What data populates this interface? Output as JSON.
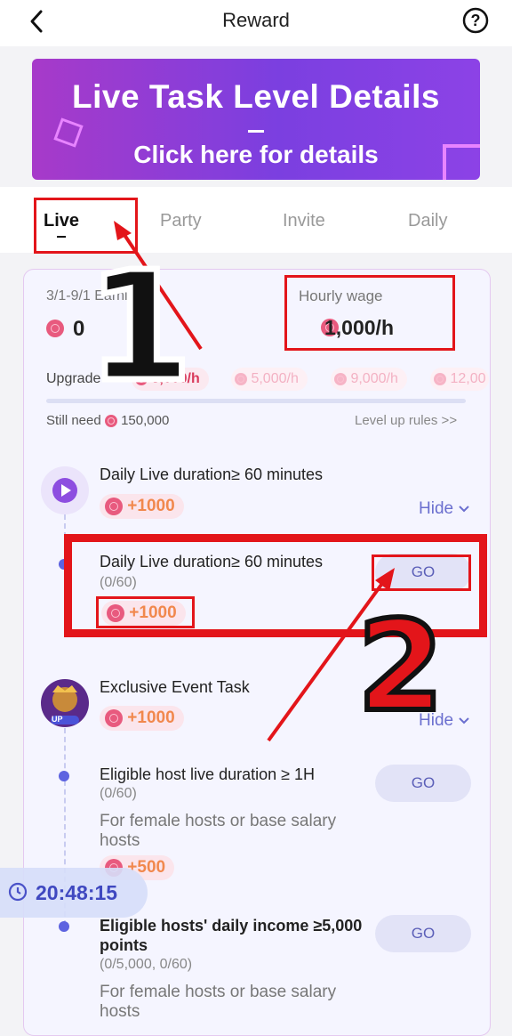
{
  "header": {
    "title": "Reward"
  },
  "banner": {
    "line1": "Live Task Level Details",
    "dash": "—",
    "line2": "Click here for details"
  },
  "tabs": [
    {
      "label": "Live"
    },
    {
      "label": "Party"
    },
    {
      "label": "Invite"
    },
    {
      "label": "Daily"
    }
  ],
  "earnings": {
    "period_label": "3/1-9/1 Earnings:",
    "value": "0",
    "hourly_label": "Hourly wage",
    "hourly_value": "1,000/h"
  },
  "upgrade": {
    "label": "Upgrade",
    "levels": [
      "3,000/h",
      "5,000/h",
      "9,000/h",
      "12,00"
    ],
    "still_need_label": "Still need",
    "still_need_value": "150,000",
    "rules_link": "Level up rules >>",
    "progress": 0
  },
  "task1": {
    "title": "Daily Live duration≥ 60 minutes",
    "bonus": "+1000",
    "hide_label": "Hide",
    "sub": {
      "title": "Daily Live duration≥ 60 minutes",
      "progress": "(0/60)",
      "bonus": "+1000",
      "go_label": "GO"
    }
  },
  "task2": {
    "title": "Exclusive Event Task",
    "badge": "UP",
    "bonus": "+1000",
    "hide_label": "Hide",
    "subs": [
      {
        "title": "Eligible host live duration ≥ 1H",
        "progress": "(0/60)",
        "note": "For female hosts or base salary hosts",
        "bonus": "+500",
        "go_label": "GO"
      },
      {
        "title": "Eligible hosts' daily income ≥5,000 points",
        "progress": "(0/5,000, 0/60)",
        "note": "For female hosts or base salary hosts",
        "go_label": "GO"
      }
    ]
  },
  "timer": {
    "value": "20:48:15"
  },
  "annotations": {
    "label1": "1",
    "label2": "2"
  },
  "colors": {
    "accent": "#5d63e0",
    "coin": "#e85a7e",
    "annotation_red": "#e3151a"
  }
}
